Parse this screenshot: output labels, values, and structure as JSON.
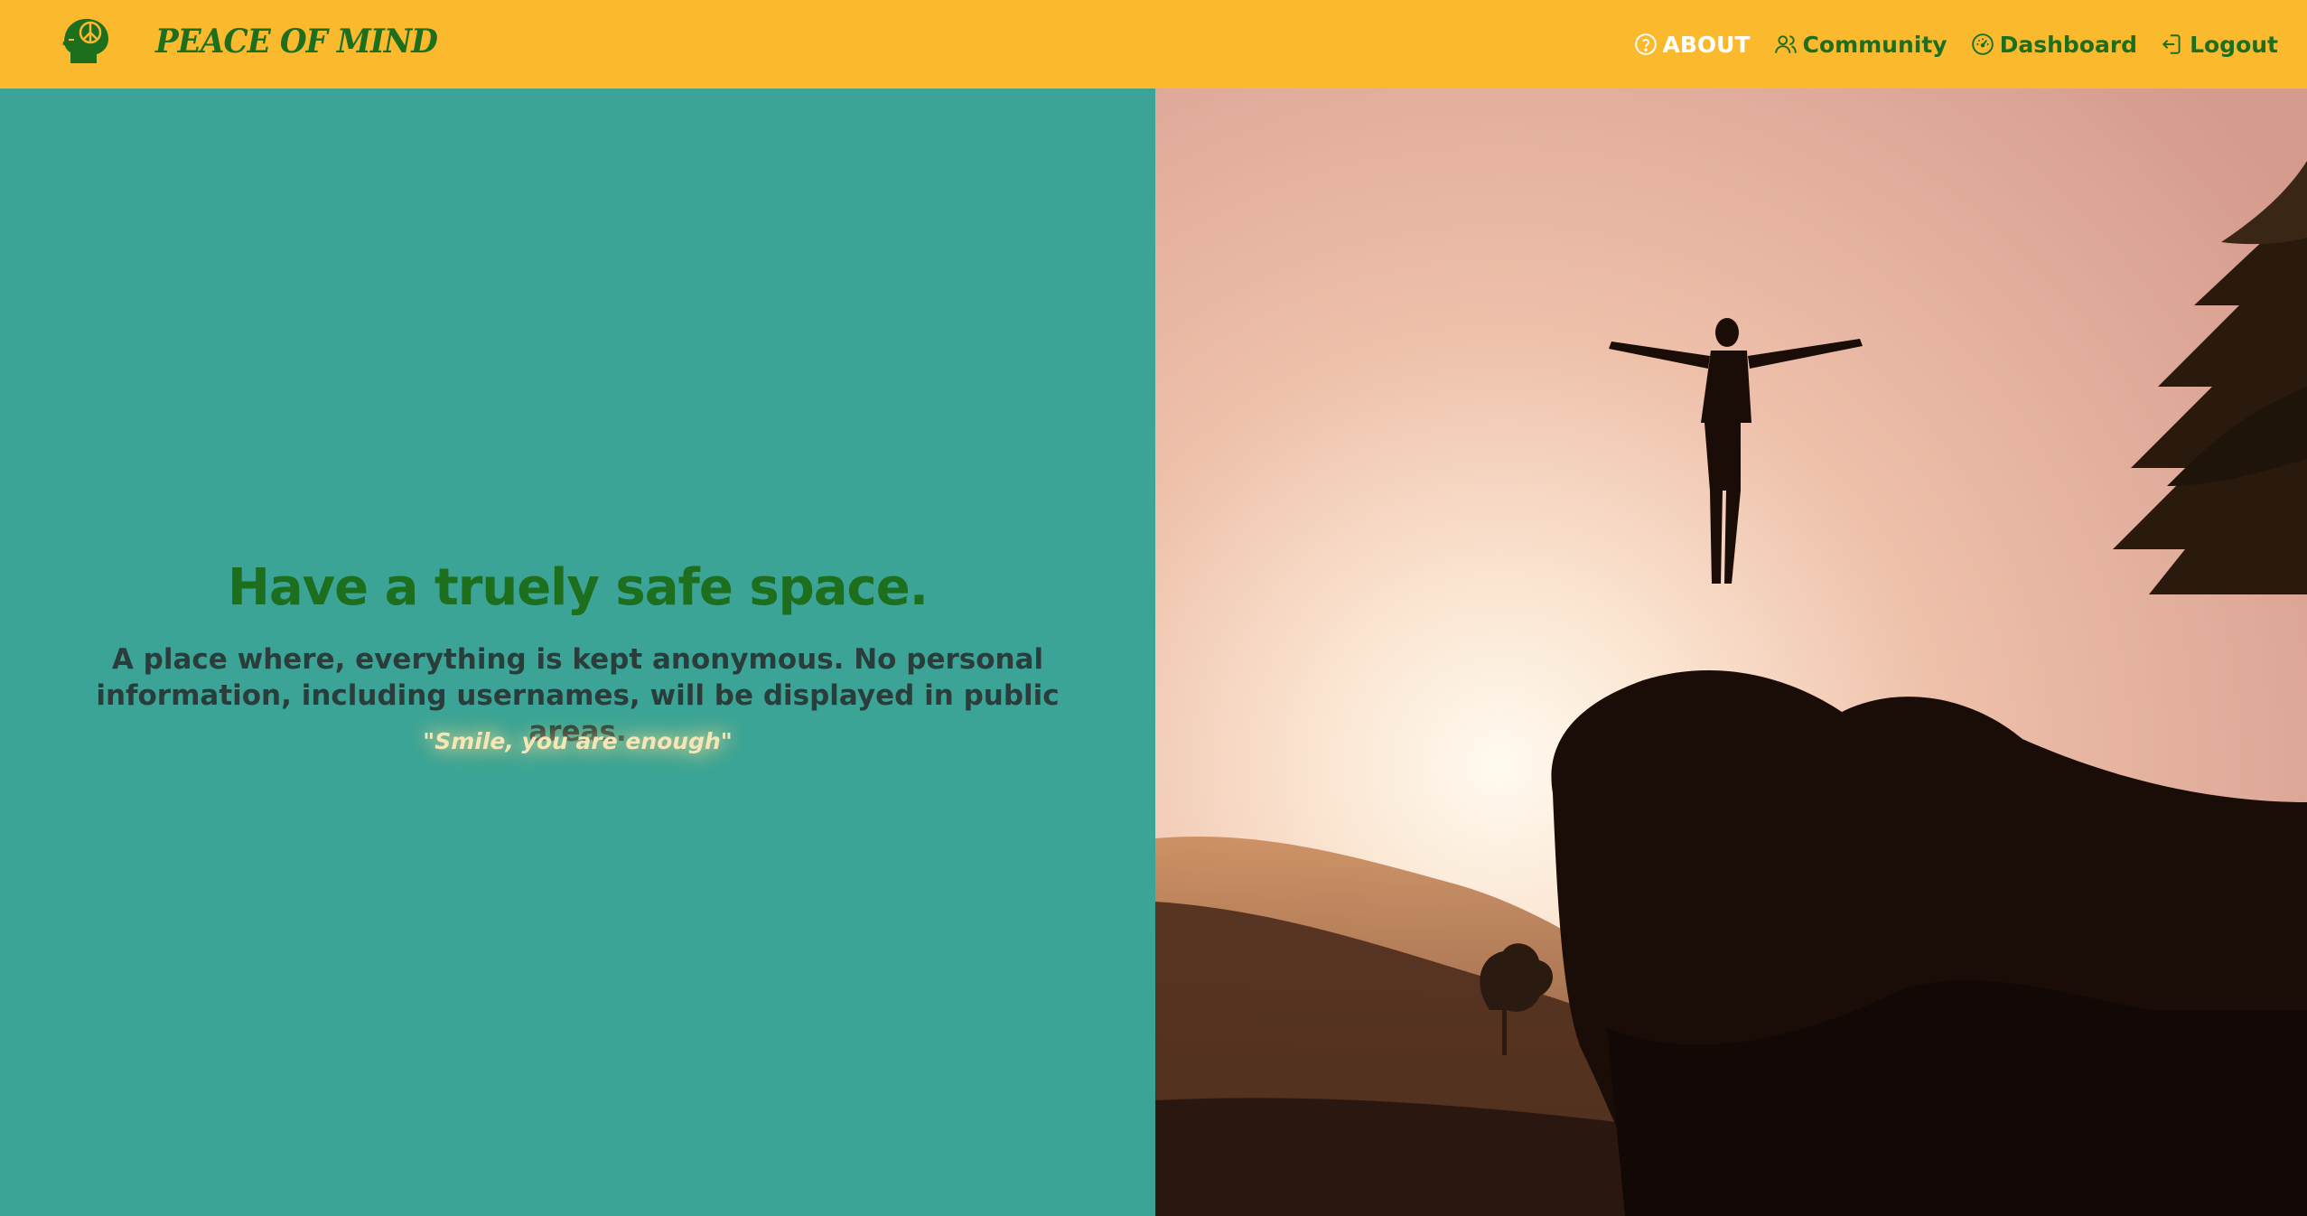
{
  "brand": {
    "name": "PEACE OF MIND",
    "icon": "peace-head-icon"
  },
  "nav": {
    "items": [
      {
        "label": "ABOUT",
        "icon": "question-circle-icon"
      },
      {
        "label": "Community",
        "icon": "people-icon"
      },
      {
        "label": "Dashboard",
        "icon": "gauge-icon"
      },
      {
        "label": "Logout",
        "icon": "logout-icon"
      }
    ]
  },
  "hero": {
    "headline": "Have a truely safe space.",
    "subtext": "A place where, everything is kept anonymous. No personal information, including usernames, will be displayed in public areas.",
    "quote": "\"Smile, you are enough\""
  },
  "colors": {
    "navbar": "#fbba2e",
    "brand_green": "#1d6e1d",
    "panel_teal": "#3ba497",
    "text_dark": "#2a3d3a",
    "quote_glow": "#f5e6b8"
  },
  "image": {
    "icon": "man-on-rock-sunset-photo"
  }
}
